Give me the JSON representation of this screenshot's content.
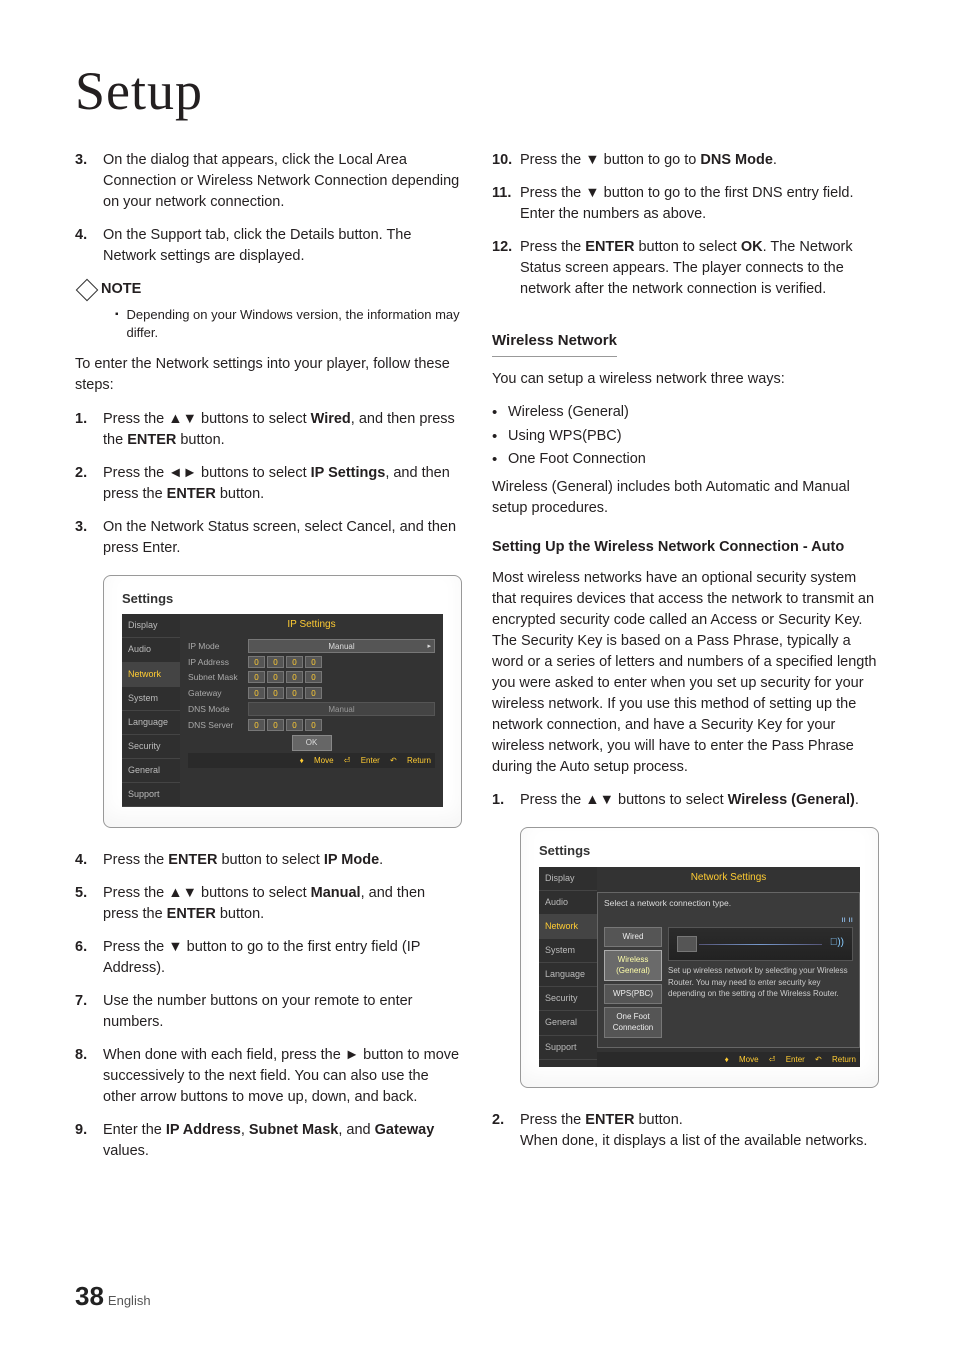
{
  "title": "Setup",
  "page": {
    "number": "38",
    "lang": "English"
  },
  "left": {
    "step3": {
      "n": "3.",
      "t_a": "On the dialog that appears, click the Local Area Connection or Wireless Network Connection depending on your network connection."
    },
    "step4": {
      "n": "4.",
      "t_a": "On the Support tab, click the Details button. The Network settings are displayed."
    },
    "note_label": "NOTE",
    "note_bullet": "Depending on your Windows version, the information may differ.",
    "intro": "To enter the Network settings into your player, follow these steps:",
    "s1": {
      "n": "1.",
      "a": "Press the ▲▼ buttons to select ",
      "b": "Wired",
      "c": ", and then press the ",
      "d": "ENTER",
      "e": " button."
    },
    "s2": {
      "n": "2.",
      "a": "Press the ◄► buttons to select ",
      "b": "IP Settings",
      "c": ", and then press the ",
      "d": "ENTER",
      "e": " button."
    },
    "s3": {
      "n": "3.",
      "a": "On the Network Status screen, select Cancel, and then press Enter."
    },
    "s4": {
      "n": "4.",
      "a": "Press the ",
      "b": "ENTER",
      "c": " button to select ",
      "d": "IP Mode",
      "e": "."
    },
    "s5": {
      "n": "5.",
      "a": "Press the ▲▼ buttons to select ",
      "b": "Manual",
      "c": ", and then press the ",
      "d": "ENTER",
      "e": " button."
    },
    "s6": {
      "n": "6.",
      "a": "Press the ▼ button to go to the first entry field (IP Address)."
    },
    "s7": {
      "n": "7.",
      "a": "Use the number buttons on your remote to enter numbers."
    },
    "s8": {
      "n": "8.",
      "a": "When done with each field, press the ► button to move successively to the next field. You can also use the other arrow buttons to move up, down, and back."
    },
    "s9": {
      "n": "9.",
      "a": "Enter the ",
      "b": "IP Address",
      "c": ", ",
      "d": "Subnet Mask",
      "e": ", and ",
      "f": "Gateway",
      "g": " values."
    }
  },
  "right": {
    "s10": {
      "n": "10.",
      "a": "Press the ▼ button to go to ",
      "b": "DNS Mode",
      "c": "."
    },
    "s11": {
      "n": "11.",
      "a": "Press the ▼ button to go to the first DNS entry field. Enter the numbers as above."
    },
    "s12": {
      "n": "12.",
      "a": "Press the ",
      "b": "ENTER",
      "c": " button to select ",
      "d": "OK",
      "e": ". The Network Status screen appears. The player connects to the network after the network connection is verified."
    },
    "wireless_heading": "Wireless Network",
    "wireless_intro": "You can setup a wireless network three ways:",
    "wu1": "Wireless (General)",
    "wu2": "Using WPS(PBC)",
    "wu3": "One Foot Connection",
    "wireless_para": "Wireless (General) includes both Automatic and Manual setup procedures.",
    "auto_heading": "Setting Up the Wireless Network Connection - Auto",
    "auto_para": "Most wireless networks have an optional security system that requires devices that access the network to transmit an encrypted security code called an Access or Security Key. The Security Key is based on a Pass Phrase, typically a word or a series of letters and numbers of a specified length you were asked to enter when you set up security for your wireless network. If you use this method of setting up the network connection, and have a Security Key for your wireless network, you will have to enter the Pass Phrase during the Auto setup process.",
    "a1": {
      "n": "1.",
      "a": "Press the ▲▼ buttons to select ",
      "b": "Wireless (General)",
      "c": "."
    },
    "a2": {
      "n": "2.",
      "a": "Press the ",
      "b": "ENTER",
      "c": " button.",
      "d": "When done, it displays a list of the available networks."
    }
  },
  "shot1": {
    "box_title": "Settings",
    "header": "IP Settings",
    "side": [
      "Display",
      "Audio",
      "Network",
      "System",
      "Language",
      "Security",
      "General",
      "Support"
    ],
    "ipmode_label": "IP Mode",
    "ipmode_val": "Manual",
    "ipaddr": "IP Address",
    "subnet": "Subnet Mask",
    "gateway": "Gateway",
    "dnsmode_label": "DNS Mode",
    "dnsmode_val": "Manual",
    "dnsserver": "DNS Server",
    "oct": "0",
    "ok": "OK",
    "footer": {
      "move": "Move",
      "enter": "Enter",
      "return": "Return"
    }
  },
  "shot2": {
    "box_title": "Settings",
    "header": "Network Settings",
    "popup_text": "Select a network connection type.",
    "side": [
      "Display",
      "Audio",
      "Network",
      "System",
      "Language",
      "Security",
      "General",
      "Support"
    ],
    "types": {
      "wired": "Wired",
      "wireless": "Wireless (General)",
      "wps": "WPS(PBC)",
      "onefoot": "One Foot Connection"
    },
    "desc": "Set up wireless network by selecting your Wireless Router. You may need to enter security key depending on the setting of the Wireless Router.",
    "footer": {
      "move": "Move",
      "enter": "Enter",
      "return": "Return"
    }
  }
}
